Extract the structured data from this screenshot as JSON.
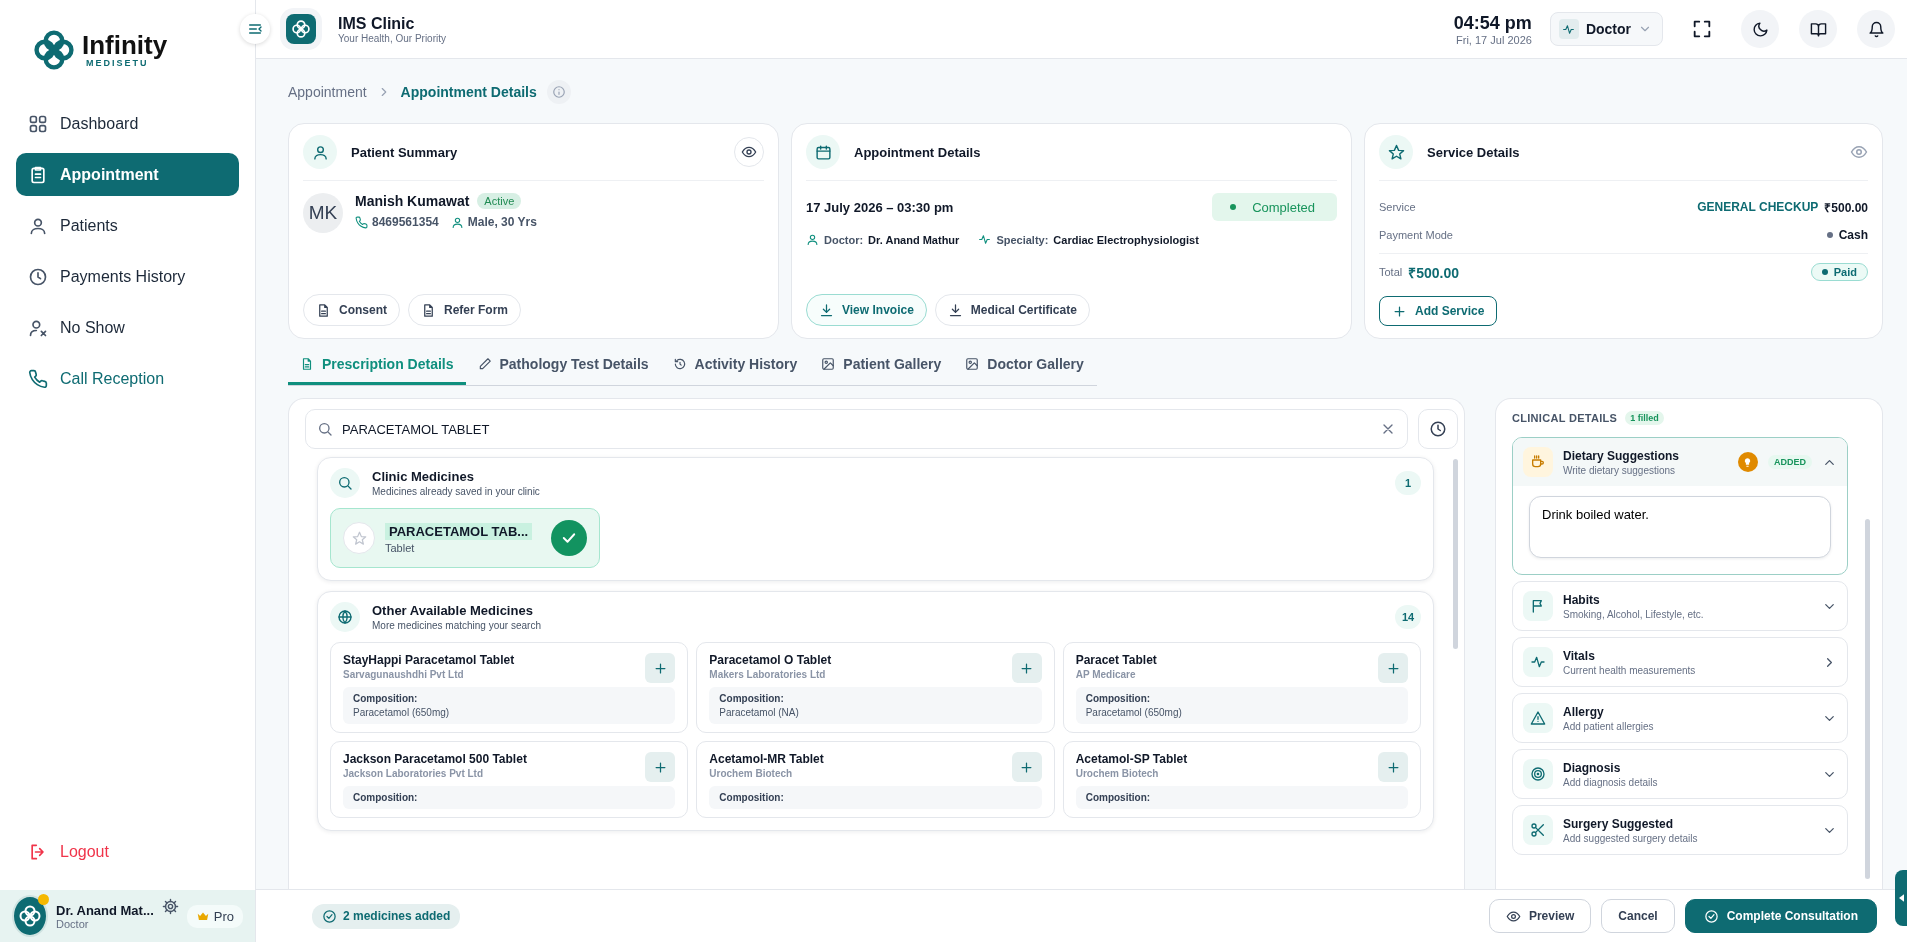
{
  "sidebar": {
    "logo": {
      "name": "Infinity",
      "sub": "MEDISETU"
    },
    "items": [
      {
        "label": "Dashboard",
        "selected": false
      },
      {
        "label": "Appointment",
        "selected": true
      },
      {
        "label": "Patients",
        "selected": false
      },
      {
        "label": "Payments History",
        "selected": false
      },
      {
        "label": "No Show",
        "selected": false
      },
      {
        "label": "Call Reception",
        "selected": false
      }
    ],
    "logout": "Logout",
    "user": {
      "name": "Dr. Anand Mat...",
      "role": "Doctor",
      "plan": "Pro"
    }
  },
  "header": {
    "clinic": "IMS Clinic",
    "tagline": "Your Health, Our Priority",
    "time": "04:54 pm",
    "date": "Fri, 17 Jul 2026",
    "role": "Doctor"
  },
  "breadcrumb": [
    "Appointment",
    "Appointment Details"
  ],
  "patient_summary": {
    "title": "Patient Summary",
    "initials": "MK",
    "name": "Manish Kumawat",
    "status": "Active",
    "phone": "8469561354",
    "gender_age": "Male, 30 Yrs",
    "buttons": [
      "Consent",
      "Refer Form"
    ]
  },
  "appointment_details": {
    "title": "Appointment Details",
    "datetime": "17 July 2026 – 03:30 pm",
    "status": "Completed",
    "doctor_label": "Doctor:",
    "doctor": "Dr. Anand Mathur",
    "specialty_label": "Specialty:",
    "specialty": "Cardiac Electrophysiologist",
    "buttons": [
      {
        "label": "View Invoice",
        "kind": "primary"
      },
      {
        "label": "Medical Certificate",
        "kind": "plain"
      }
    ]
  },
  "service_details": {
    "title": "Service Details",
    "service_label": "Service",
    "service": "GENERAL CHECKUP",
    "service_amount": "₹500.00",
    "payment_label": "Payment Mode",
    "payment": "Cash",
    "total_label": "Total",
    "total": "₹500.00",
    "payment_status": "Paid",
    "add_button": "Add Service"
  },
  "tabs": [
    {
      "label": "Prescription Details",
      "selected": true
    },
    {
      "label": "Pathology Test Details",
      "selected": false
    },
    {
      "label": "Activity History",
      "selected": false
    },
    {
      "label": "Patient Gallery",
      "selected": false
    },
    {
      "label": "Doctor Gallery",
      "selected": false
    }
  ],
  "search": {
    "value": "PARACETAMOL TABLET"
  },
  "clinic_medicines": {
    "title": "Clinic Medicines",
    "subtitle": "Medicines already saved in your clinic",
    "count": "1",
    "items": [
      {
        "name": "PARACETAMOL TAB...",
        "form": "Tablet",
        "selected": true
      }
    ]
  },
  "other_medicines": {
    "title": "Other Available Medicines",
    "subtitle": "More medicines matching your search",
    "count": "14",
    "items": [
      {
        "name": "StayHappi Paracetamol Tablet",
        "maker": "Sarvagunaushdhi Pvt Ltd",
        "composition_label": "Composition:",
        "composition": "Paracetamol (650mg)"
      },
      {
        "name": "Paracetamol O Tablet",
        "maker": "Makers Laboratories Ltd",
        "composition_label": "Composition:",
        "composition": "Paracetamol (NA)"
      },
      {
        "name": "Paracet Tablet",
        "maker": "AP Medicare",
        "composition_label": "Composition:",
        "composition": "Paracetamol (650mg)"
      },
      {
        "name": "Jackson Paracetamol 500 Tablet",
        "maker": "Jackson Laboratories Pvt Ltd",
        "composition_label": "Composition:"
      },
      {
        "name": "Acetamol-MR Tablet",
        "maker": "Urochem Biotech",
        "composition_label": "Composition:"
      },
      {
        "name": "Acetamol-SP Tablet",
        "maker": "Urochem Biotech",
        "composition_label": "Composition:"
      }
    ]
  },
  "clinical_details": {
    "title": "CLINICAL DETAILS",
    "filled": "1 filled",
    "sections": [
      {
        "title": "Dietary Suggestions",
        "subtitle": "Write dietary suggestions",
        "kind": "accordion",
        "expanded": true,
        "badge": "ADDED",
        "value": "Drink boiled water."
      },
      {
        "title": "Habits",
        "subtitle": "Smoking, Alcohol, Lifestyle, etc.",
        "kind": "accordion",
        "expanded": false
      },
      {
        "title": "Vitals",
        "subtitle": "Current health measurements",
        "kind": "link",
        "expanded": false
      },
      {
        "title": "Allergy",
        "subtitle": "Add patient allergies",
        "kind": "accordion",
        "expanded": false
      },
      {
        "title": "Diagnosis",
        "subtitle": "Add diagnosis details",
        "kind": "accordion",
        "expanded": false
      },
      {
        "title": "Surgery Suggested",
        "subtitle": "Add suggested surgery details",
        "kind": "accordion",
        "expanded": false
      }
    ]
  },
  "footer": {
    "status": "2 medicines added",
    "preview": "Preview",
    "cancel": "Cancel",
    "complete": "Complete Consultation"
  }
}
